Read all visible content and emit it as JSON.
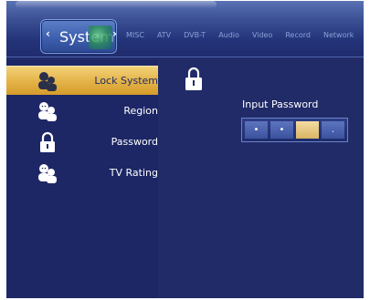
{
  "header": {
    "active_tab": "System",
    "tabs": [
      "MISC",
      "ATV",
      "DVB-T",
      "Audio",
      "Video",
      "Record",
      "Network"
    ]
  },
  "menu": {
    "items": [
      {
        "label": "Lock System",
        "icon": "user-pair-icon",
        "selected": true
      },
      {
        "label": "Region",
        "icon": "user-pair-icon",
        "selected": false
      },
      {
        "label": "Password",
        "icon": "padlock-icon",
        "selected": false
      },
      {
        "label": "TV Rating",
        "icon": "user-pair-icon",
        "selected": false
      }
    ]
  },
  "password": {
    "label": "Input Password",
    "digits": [
      "•",
      "•",
      "",
      "."
    ],
    "active_index": 2
  },
  "colors": {
    "background": "#202b68",
    "highlight": "#e5b54a",
    "text": "#ffffff"
  }
}
